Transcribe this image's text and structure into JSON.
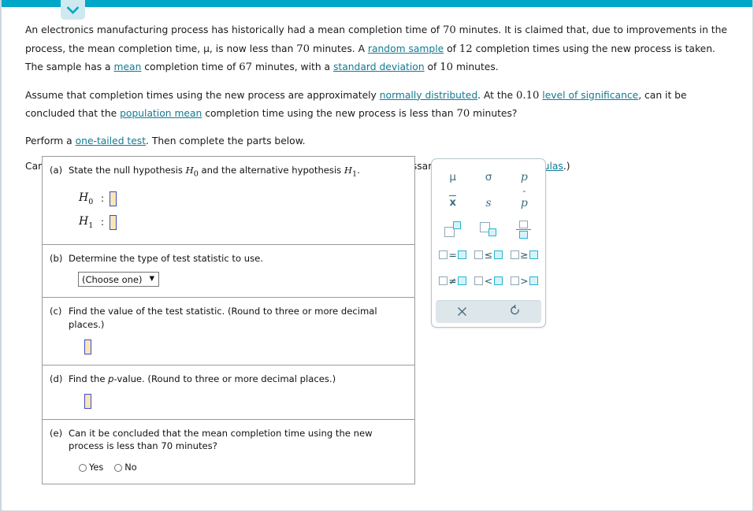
{
  "topbar": {
    "color": "#00a7c8"
  },
  "collapse_tab": {
    "icon": "chevron-down-icon",
    "color": "#00a7c8",
    "bg": "#cfe9f0"
  },
  "problem": {
    "paragraph1": {
      "segments": [
        {
          "type": "text",
          "text": "An electronics manufacturing process has historically had a mean completion time of "
        },
        {
          "type": "num",
          "text": "70"
        },
        {
          "type": "text",
          "text": " minutes. It is claimed that, due to improvements in the process, the mean completion time, "
        },
        {
          "type": "sym",
          "text": "μ"
        },
        {
          "type": "text",
          "text": ", is now less than "
        },
        {
          "type": "num",
          "text": "70"
        },
        {
          "type": "text",
          "text": " minutes. A "
        },
        {
          "type": "link",
          "text": "random sample"
        },
        {
          "type": "text",
          "text": " of "
        },
        {
          "type": "num",
          "text": "12"
        },
        {
          "type": "text",
          "text": " completion times using the new process is taken. The sample has a "
        },
        {
          "type": "link",
          "text": "mean"
        },
        {
          "type": "text",
          "text": " completion time of "
        },
        {
          "type": "num",
          "text": "67"
        },
        {
          "type": "text",
          "text": " minutes, with a "
        },
        {
          "type": "link",
          "text": "standard deviation"
        },
        {
          "type": "text",
          "text": " of "
        },
        {
          "type": "num",
          "text": "10"
        },
        {
          "type": "text",
          "text": " minutes."
        }
      ]
    },
    "paragraph2": {
      "segments": [
        {
          "type": "text",
          "text": "Assume that completion times using the new process are approximately "
        },
        {
          "type": "link",
          "text": "normally distributed"
        },
        {
          "type": "text",
          "text": ". At the "
        },
        {
          "type": "num",
          "text": "0.10"
        },
        {
          "type": "text",
          "text": " "
        },
        {
          "type": "link",
          "text": "level of significance"
        },
        {
          "type": "text",
          "text": ", can it be concluded that the "
        },
        {
          "type": "link",
          "text": "population mean"
        },
        {
          "type": "text",
          "text": " completion time using the new process is less than "
        },
        {
          "type": "num",
          "text": "70"
        },
        {
          "type": "text",
          "text": " minutes?"
        }
      ]
    },
    "paragraph3": {
      "segments": [
        {
          "type": "text",
          "text": "Perform a "
        },
        {
          "type": "link",
          "text": "one-tailed test"
        },
        {
          "type": "text",
          "text": ". Then complete the parts below."
        }
      ]
    },
    "paragraph4": {
      "segments": [
        {
          "type": "text",
          "text": "Carry your intermediate computations to three or more decimal places. (If necessary, consult a "
        },
        {
          "type": "link",
          "text": "list of formulas"
        },
        {
          "type": "text",
          "text": ".)"
        }
      ]
    }
  },
  "parts": {
    "a": {
      "label": "(a)",
      "prompt_pre": "State the null hypothesis ",
      "prompt_h0": "H",
      "prompt_h0_sub": "0",
      "prompt_mid": " and the alternative hypothesis ",
      "prompt_h1": "H",
      "prompt_h1_sub": "1",
      "prompt_post": ".",
      "rows": [
        {
          "name": "H",
          "sub": "0",
          "colon": ":",
          "value": ""
        },
        {
          "name": "H",
          "sub": "1",
          "colon": ":",
          "value": ""
        }
      ]
    },
    "b": {
      "label": "(b)",
      "prompt": "Determine the type of test statistic to use.",
      "dropdown": {
        "selected": "(Choose one)",
        "caret": "▼"
      }
    },
    "c": {
      "label": "(c)",
      "prompt": "Find the value of the test statistic. (Round to three or more decimal places.)",
      "value": ""
    },
    "d": {
      "label": "(d)",
      "prompt_pre": "Find the ",
      "prompt_italic": "p",
      "prompt_post": "-value. (Round to three or more decimal places.)",
      "value": ""
    },
    "e": {
      "label": "(e)",
      "prompt": "Can it be concluded that the mean completion time using the new process is less than 70 minutes?",
      "options": [
        {
          "label": "Yes",
          "selected": false
        },
        {
          "label": "No",
          "selected": false
        }
      ]
    }
  },
  "palette": {
    "rows": [
      [
        {
          "kind": "sym",
          "name": "mu-symbol",
          "text": "μ",
          "style": "roman"
        },
        {
          "kind": "sym",
          "name": "sigma-symbol",
          "text": "σ",
          "style": "roman"
        },
        {
          "kind": "sym",
          "name": "p-symbol",
          "text": "p",
          "style": "italic"
        }
      ],
      [
        {
          "kind": "sym",
          "name": "x-bar-symbol",
          "text": "x",
          "style": "bar"
        },
        {
          "kind": "sym",
          "name": "s-symbol",
          "text": "s",
          "style": "italic"
        },
        {
          "kind": "sym",
          "name": "p-hat-symbol",
          "text": "p",
          "style": "hat"
        }
      ],
      [
        {
          "kind": "box",
          "name": "superscript-icon"
        },
        {
          "kind": "box",
          "name": "subscript-icon"
        },
        {
          "kind": "box",
          "name": "fraction-icon"
        }
      ],
      [
        {
          "kind": "op",
          "name": "equals-template",
          "op": "="
        },
        {
          "kind": "op",
          "name": "less-than-or-equal-template",
          "op": "≤"
        },
        {
          "kind": "op",
          "name": "greater-than-or-equal-template",
          "op": "≥"
        }
      ],
      [
        {
          "kind": "op",
          "name": "not-equal-template",
          "op": "≠"
        },
        {
          "kind": "op",
          "name": "less-than-template",
          "op": "<"
        },
        {
          "kind": "op",
          "name": "greater-than-template",
          "op": ">"
        }
      ]
    ],
    "footer": [
      {
        "name": "clear-icon",
        "glyph": "✕"
      },
      {
        "name": "undo-icon",
        "glyph": "↺"
      }
    ],
    "colors": {
      "symbol": "#3d6e82",
      "cyan": "#1fb6d4",
      "gray": "#8fa6b2",
      "footer_bg": "#dde6ea"
    }
  }
}
